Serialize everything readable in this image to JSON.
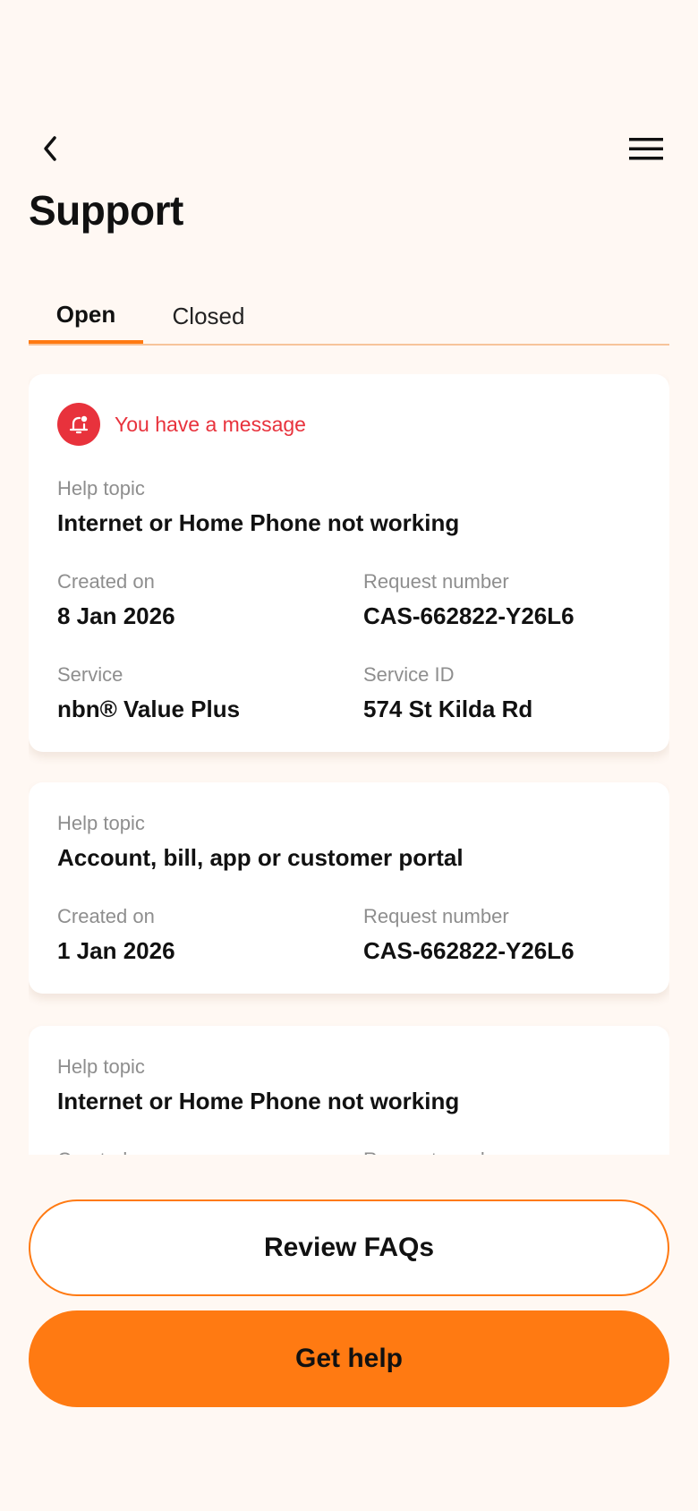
{
  "header": {
    "title": "Support",
    "back_icon": "chevron-left-icon",
    "menu_icon": "hamburger-menu-icon"
  },
  "tabs": [
    {
      "label": "Open",
      "active": true
    },
    {
      "label": "Closed",
      "active": false
    }
  ],
  "requests": [
    {
      "notice": "You have a message",
      "help_topic_label": "Help topic",
      "help_topic": "Internet or Home Phone not working",
      "created_label": "Created on",
      "created": "8 Jan 2026",
      "request_number_label": "Request number",
      "request_number": "CAS-662822-Y26L6",
      "service_label": "Service",
      "service": "nbn® Value Plus",
      "service_id_label": "Service ID",
      "service_id": "574 St Kilda Rd"
    },
    {
      "help_topic_label": "Help topic",
      "help_topic": "Account, bill, app or customer portal",
      "created_label": "Created on",
      "created": "1 Jan 2026",
      "request_number_label": "Request number",
      "request_number": "CAS-662822-Y26L6"
    },
    {
      "help_topic_label": "Help topic",
      "help_topic": "Internet or Home Phone not working",
      "created_label": "Created on",
      "request_number_label": "Request number"
    }
  ],
  "actions": {
    "faq_label": "Review FAQs",
    "help_label": "Get help"
  },
  "colors": {
    "accent": "#FF7A12",
    "alert": "#E8323C",
    "background": "#FFF8F3"
  }
}
